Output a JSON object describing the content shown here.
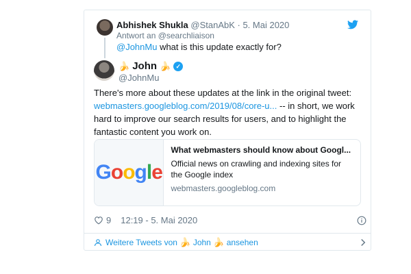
{
  "parent_tweet": {
    "author_name": "Abhishek Shukla",
    "author_handle": "@StanAbK",
    "separator": " · ",
    "date": "5. Mai 2020",
    "reply_to": "Antwort an @searchliaison",
    "mention": "@JohnMu",
    "text": " what is this update exactly for?"
  },
  "main_tweet": {
    "emoji": "🍌",
    "author_name": "John",
    "author_handle": "@JohnMu",
    "verified_mark": "✓",
    "text_part1": "There's more about these updates at the link in the original tweet: ",
    "link_text": "webmasters.googleblog.com/2019/08/core-u...",
    "text_part2": " -- in short, we work hard to improve our search results for users, and to highlight the fantastic content you work on.",
    "link_card": {
      "logo_text": "Google",
      "title": "What webmasters should know about Googl...",
      "description": "Official news on crawling and indexing sites for the Google index",
      "domain": "webmasters.googleblog.com"
    },
    "likes": "9",
    "timestamp": "12:19 - 5. Mai 2020"
  },
  "footer": {
    "more_label_prefix": "Weitere Tweets von ",
    "more_label_name": "John",
    "more_label_suffix": " ansehen"
  },
  "icons": {
    "twitter": "twitter-bird-icon",
    "heart": "heart-icon",
    "info": "info-icon",
    "person": "person-icon",
    "chevron": "chevron-right-icon"
  },
  "colors": {
    "link_blue": "#1b95e0",
    "twitter_blue": "#1da1f2",
    "muted_gray": "#657786",
    "border": "#e1e8ed"
  }
}
